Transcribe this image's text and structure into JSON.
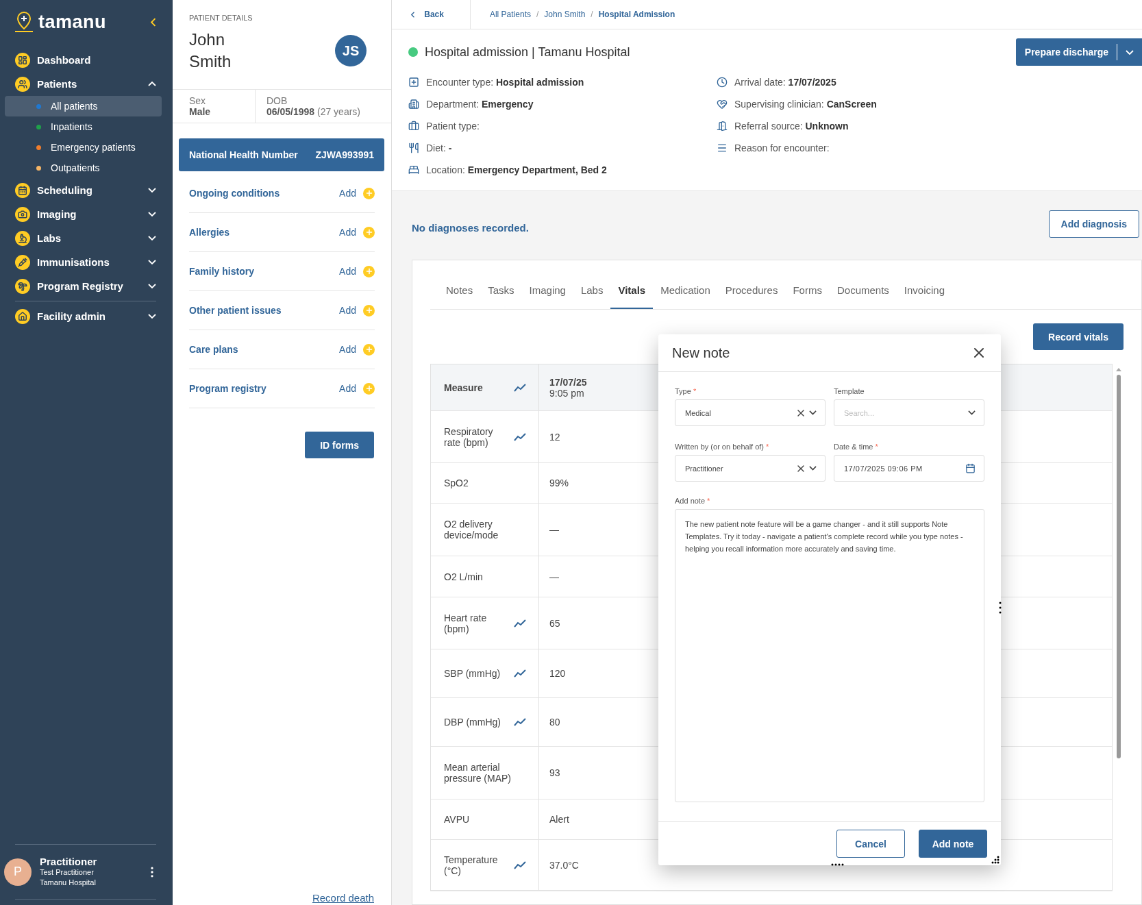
{
  "sidebar": {
    "logo": "tamanu",
    "items": [
      {
        "label": "Dashboard",
        "kind": "link"
      },
      {
        "label": "Patients",
        "kind": "group",
        "expanded": true,
        "children": [
          {
            "label": "All patients",
            "color": "#1f78d1",
            "selected": true
          },
          {
            "label": "Inpatients",
            "color": "#1fa04a",
            "selected": false
          },
          {
            "label": "Emergency patients",
            "color": "#f07d2c",
            "selected": false
          },
          {
            "label": "Outpatients",
            "color": "#f5b566",
            "selected": false
          }
        ]
      },
      {
        "label": "Scheduling",
        "kind": "group",
        "expanded": false
      },
      {
        "label": "Imaging",
        "kind": "group",
        "expanded": false
      },
      {
        "label": "Labs",
        "kind": "group",
        "expanded": false
      },
      {
        "label": "Immunisations",
        "kind": "group",
        "expanded": false
      },
      {
        "label": "Program Registry",
        "kind": "group",
        "expanded": false
      },
      {
        "label": "Facility admin",
        "kind": "group",
        "expanded": false
      }
    ],
    "user": {
      "avatar": "P",
      "name": "Practitioner",
      "role": "Test Practitioner",
      "facility": "Tamanu Hospital"
    }
  },
  "patient": {
    "heading": "PATIENT DETAILS",
    "first_name": "John",
    "last_name": "Smith",
    "initials": "JS",
    "sex": {
      "label": "Sex",
      "value": "Male"
    },
    "dob": {
      "label": "DOB",
      "value": "06/05/1998",
      "age": "(27 years)"
    },
    "nhn": {
      "label": "National Health Number",
      "value": "ZJWA993991"
    },
    "sections": [
      {
        "label": "Ongoing conditions",
        "action": "Add"
      },
      {
        "label": "Allergies",
        "action": "Add"
      },
      {
        "label": "Family history",
        "action": "Add"
      },
      {
        "label": "Other patient issues",
        "action": "Add"
      },
      {
        "label": "Care plans",
        "action": "Add"
      },
      {
        "label": "Program registry",
        "action": "Add"
      }
    ],
    "id_forms": "ID forms",
    "record_death": "Record death"
  },
  "topbar": {
    "back": "Back",
    "separator": "/",
    "breadcrumbs": [
      {
        "label": "All Patients",
        "current": false
      },
      {
        "label": "John Smith",
        "current": false
      },
      {
        "label": "Hospital Admission",
        "current": true
      }
    ]
  },
  "encounter": {
    "title": "Hospital admission | Tamanu Hospital",
    "action": "Prepare discharge",
    "details_left": [
      {
        "kind": "cross",
        "text": "Encounter type: **Hospital admission**"
      },
      {
        "kind": "building",
        "text": "Department: **Emergency**"
      },
      {
        "kind": "briefcase",
        "text": "Patient type:"
      },
      {
        "kind": "meal",
        "text": "Diet: **-**"
      },
      {
        "kind": "bed",
        "text": "Location: **Emergency Department, Bed 2**"
      }
    ],
    "details_right": [
      {
        "kind": "clock",
        "text": "Arrival date: **17/07/2025**"
      },
      {
        "kind": "hand",
        "text": "Supervising clinician: **CanScreen**"
      },
      {
        "kind": "door",
        "text": "Referral source: **Unknown**"
      },
      {
        "kind": "lines",
        "text": "Reason for encounter:"
      }
    ]
  },
  "diagnoses": {
    "message": "No diagnoses recorded.",
    "action": "Add diagnosis"
  },
  "tabs": [
    {
      "label": "Notes",
      "selected": false
    },
    {
      "label": "Tasks",
      "selected": false
    },
    {
      "label": "Imaging",
      "selected": false
    },
    {
      "label": "Labs",
      "selected": false
    },
    {
      "label": "Vitals",
      "selected": true
    },
    {
      "label": "Medication",
      "selected": false
    },
    {
      "label": "Procedures",
      "selected": false
    },
    {
      "label": "Forms",
      "selected": false
    },
    {
      "label": "Documents",
      "selected": false
    },
    {
      "label": "Invoicing",
      "selected": false
    }
  ],
  "vitals": {
    "action": "Record vitals",
    "columns": {
      "measure": "Measure",
      "date": "17/07/25",
      "time": "9:05 pm"
    },
    "rows": [
      {
        "measure": "Respiratory rate (bpm)",
        "value": "12",
        "trend": true
      },
      {
        "measure": "SpO2",
        "value": "99%",
        "trend": false
      },
      {
        "measure": "O2 delivery device/mode",
        "value": "—",
        "trend": false
      },
      {
        "measure": "O2 L/min",
        "value": "—",
        "trend": false
      },
      {
        "measure": "Heart rate (bpm)",
        "value": "65",
        "trend": true
      },
      {
        "measure": "SBP (mmHg)",
        "value": "120",
        "trend": true
      },
      {
        "measure": "DBP (mmHg)",
        "value": "80",
        "trend": true
      },
      {
        "measure": "Mean arterial pressure (MAP)",
        "value": "93",
        "trend": false
      },
      {
        "measure": "AVPU",
        "value": "Alert",
        "trend": false
      },
      {
        "measure": "Temperature (°C)",
        "value": "37.0°C",
        "trend": true
      }
    ]
  },
  "modal": {
    "title": "New note",
    "required_mark": "*",
    "type": {
      "label": "Type",
      "required": true,
      "value": "Medical"
    },
    "template": {
      "label": "Template",
      "required": false,
      "placeholder": "Search..."
    },
    "written_by": {
      "label": "Written by (or on behalf of)",
      "required": true,
      "value": "Practitioner"
    },
    "date_time": {
      "label": "Date & time",
      "required": true,
      "value": "17/07/2025 09:06 PM"
    },
    "note": {
      "label": "Add note",
      "required": true,
      "value": "The new patient note feature will be a game changer - and it still supports Note Templates. Try it today - navigate a patient's complete record while you type notes - helping you recall information more accurately and saving time."
    },
    "buttons": {
      "cancel": "Cancel",
      "confirm": "Add note"
    }
  }
}
